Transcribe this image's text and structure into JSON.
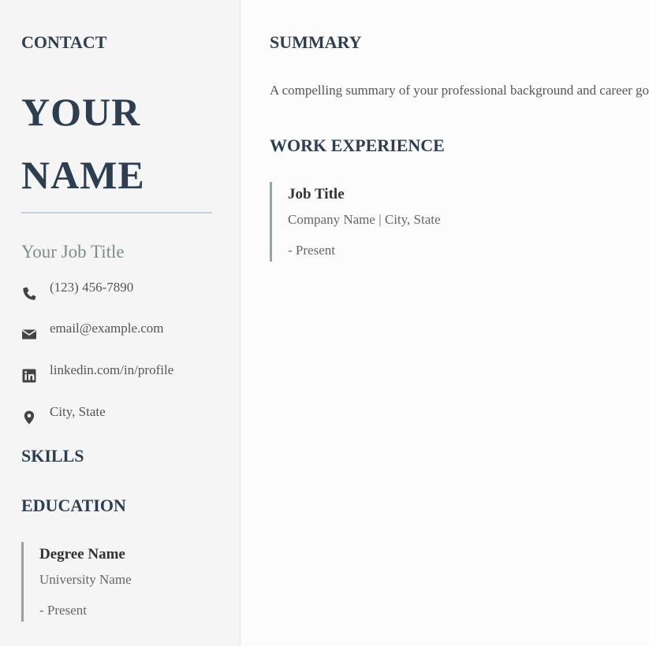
{
  "sidebar": {
    "contact_heading": "CONTACT",
    "name_line1": "YOUR",
    "name_line2": "NAME",
    "job_title": "Your Job Title",
    "contacts": [
      {
        "icon": "phone-icon",
        "text": "(123) 456-7890"
      },
      {
        "icon": "envelope-icon",
        "text": "email@example.com"
      },
      {
        "icon": "linkedin-icon",
        "text": "linkedin.com/in/profile"
      },
      {
        "icon": "location-pin-icon",
        "text": "City, State"
      }
    ],
    "skills_heading": "SKILLS",
    "education_heading": "EDUCATION",
    "education": {
      "degree": "Degree Name",
      "school": "University Name",
      "dates": "- Present"
    }
  },
  "main": {
    "summary_heading": "SUMMARY",
    "summary_text": "A compelling summary of your professional background and career goals.",
    "work_heading": "WORK EXPERIENCE",
    "job": {
      "title": "Job Title",
      "company": "Company Name | City, State",
      "dates": "- Present"
    }
  },
  "colors": {
    "heading": "#2c3e50",
    "sidebar_bg": "#f5f5f6",
    "main_bg": "#fcfcfc",
    "accent_rule": "#c5d0da",
    "entry_border": "#95a5a6"
  }
}
